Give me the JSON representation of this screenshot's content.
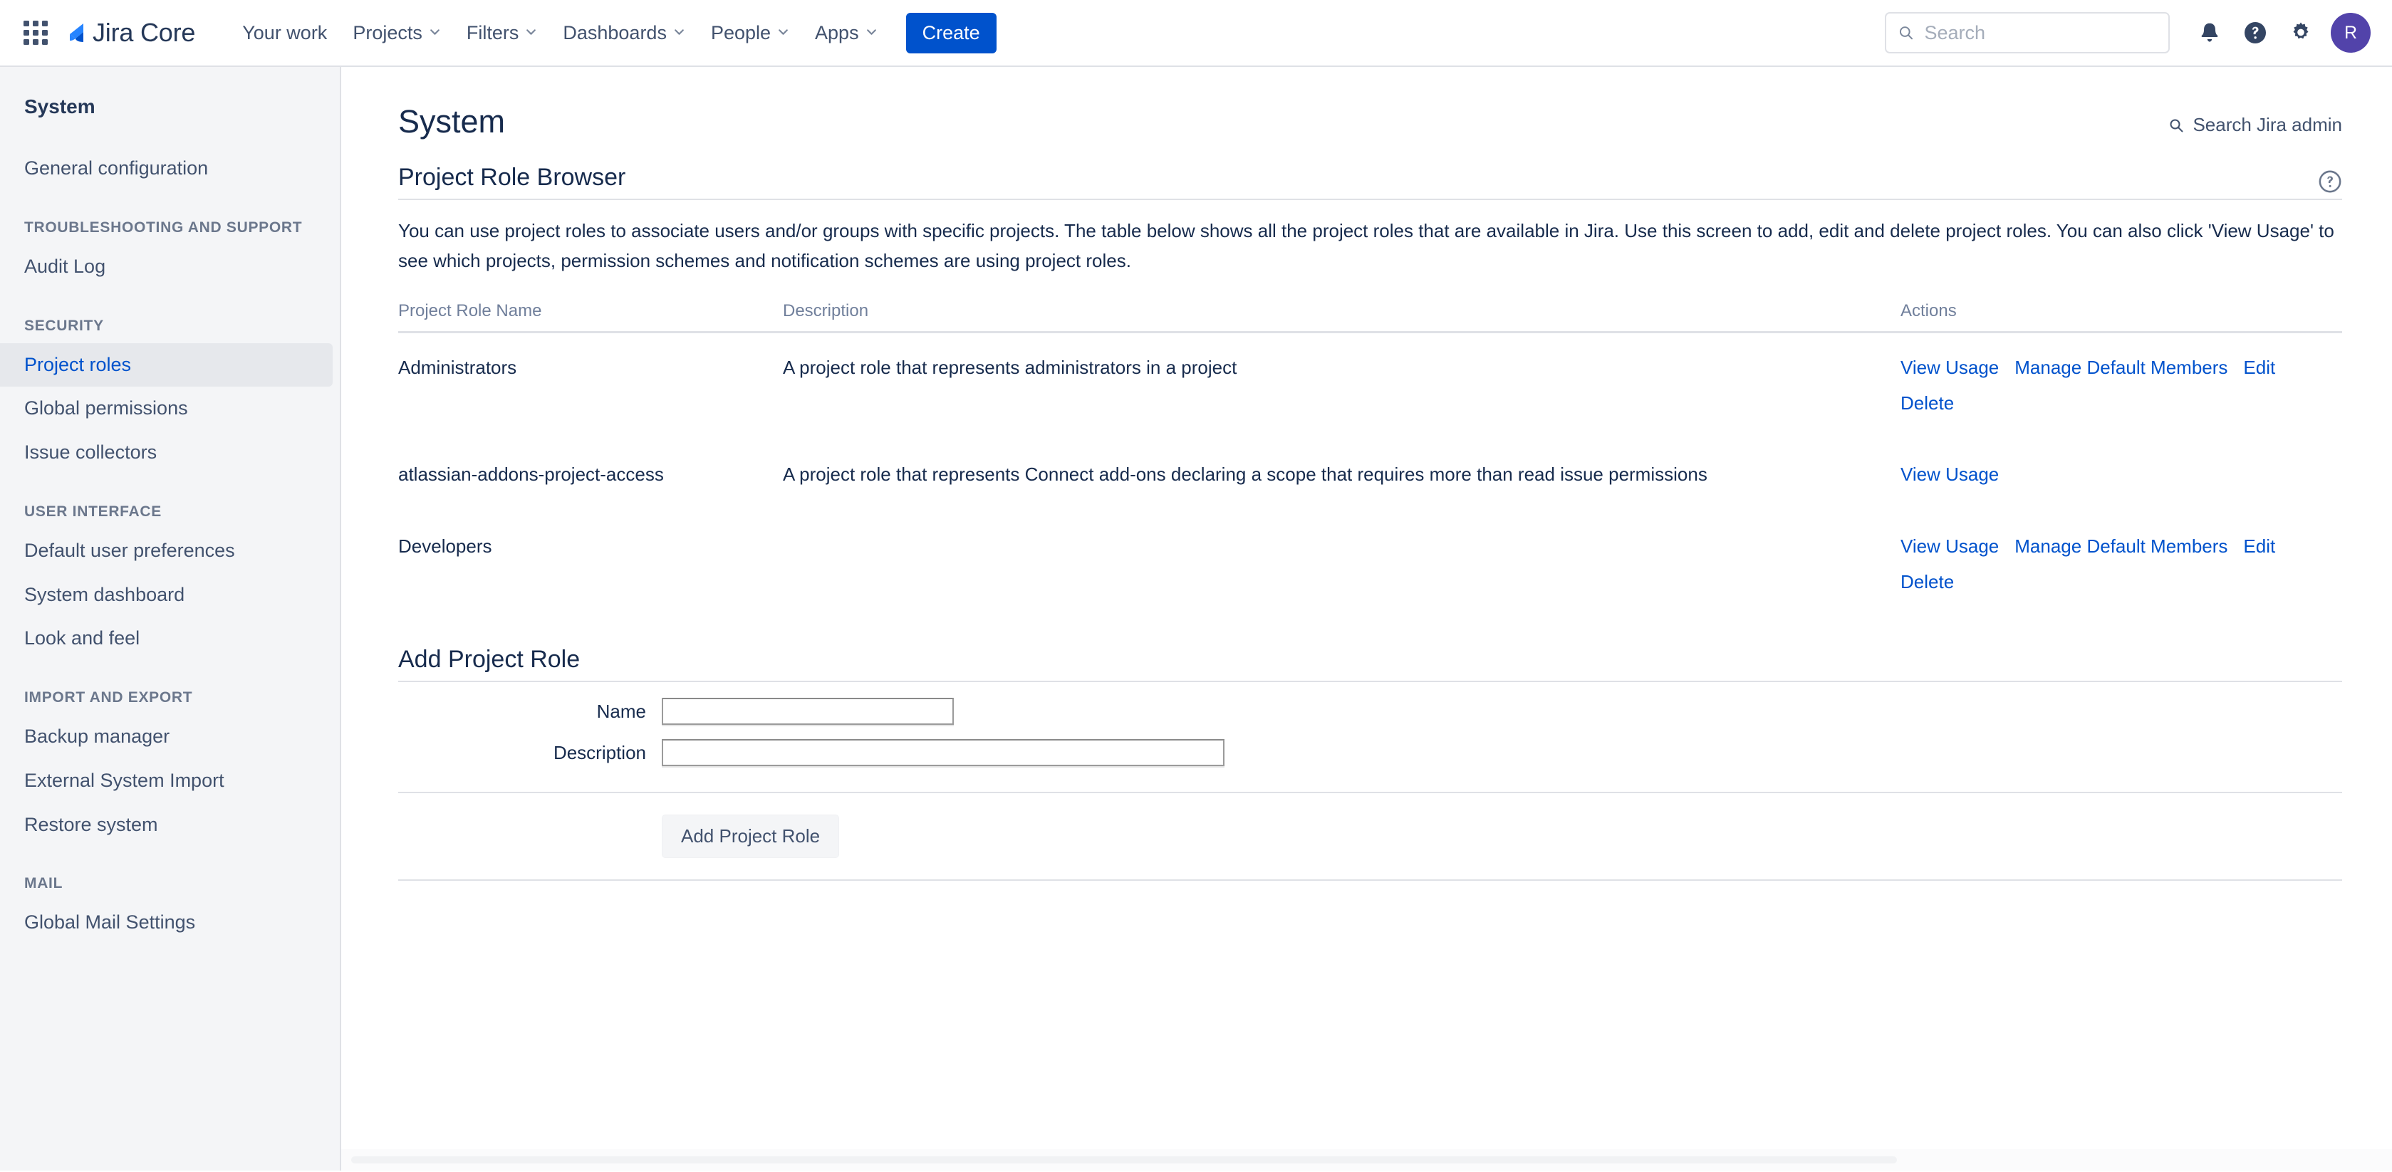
{
  "topnav": {
    "app_switcher_icon": "grid-apps-icon",
    "brand_name": "Jira Core",
    "brand_logo_icon": "jira-logo-icon",
    "items": [
      {
        "label": "Your work",
        "has_chevron": false
      },
      {
        "label": "Projects",
        "has_chevron": true
      },
      {
        "label": "Filters",
        "has_chevron": true
      },
      {
        "label": "Dashboards",
        "has_chevron": true
      },
      {
        "label": "People",
        "has_chevron": true
      },
      {
        "label": "Apps",
        "has_chevron": true
      }
    ],
    "create_label": "Create",
    "search": {
      "placeholder": "Search",
      "value": "",
      "icon": "search-icon"
    },
    "notifications_icon": "bell-icon",
    "help_icon": "help-circle-icon",
    "settings_icon": "gear-icon",
    "avatar_initial": "R",
    "avatar_color": "#5243AA"
  },
  "sidebar": {
    "title": "System",
    "groups": [
      {
        "label": "",
        "items": [
          {
            "label": "General configuration",
            "selected": false
          }
        ]
      },
      {
        "label": "TROUBLESHOOTING AND SUPPORT",
        "items": [
          {
            "label": "Audit Log",
            "selected": false
          }
        ]
      },
      {
        "label": "SECURITY",
        "items": [
          {
            "label": "Project roles",
            "selected": true
          },
          {
            "label": "Global permissions",
            "selected": false
          },
          {
            "label": "Issue collectors",
            "selected": false
          }
        ]
      },
      {
        "label": "USER INTERFACE",
        "items": [
          {
            "label": "Default user preferences",
            "selected": false
          },
          {
            "label": "System dashboard",
            "selected": false
          },
          {
            "label": "Look and feel",
            "selected": false
          }
        ]
      },
      {
        "label": "IMPORT AND EXPORT",
        "items": [
          {
            "label": "Backup manager",
            "selected": false
          },
          {
            "label": "External System Import",
            "selected": false
          },
          {
            "label": "Restore system",
            "selected": false
          }
        ]
      },
      {
        "label": "MAIL",
        "items": [
          {
            "label": "Global Mail Settings",
            "selected": false
          }
        ]
      }
    ]
  },
  "main": {
    "page_title": "System",
    "admin_search_label": "Search Jira admin",
    "admin_search_icon": "search-icon",
    "section_title": "Project Role Browser",
    "help_icon": "help-circle-icon",
    "intro": "You can use project roles to associate users and/or groups with specific projects. The table below shows all the project roles that are available in Jira. Use this screen to add, edit and delete project roles. You can also click 'View Usage' to see which projects, permission schemes and notification schemes are using project roles.",
    "table": {
      "headers": [
        "Project Role Name",
        "Description",
        "Actions"
      ],
      "rows": [
        {
          "name": "Administrators",
          "description": "A project role that represents administrators in a project",
          "actions": [
            "View Usage",
            "Manage Default Members",
            "Edit",
            "Delete"
          ]
        },
        {
          "name": "atlassian-addons-project-access",
          "description": "A project role that represents Connect add-ons declaring a scope that requires more than read issue permissions",
          "actions": [
            "View Usage"
          ]
        },
        {
          "name": "Developers",
          "description": "",
          "actions": [
            "View Usage",
            "Manage Default Members",
            "Edit",
            "Delete"
          ]
        }
      ]
    },
    "form": {
      "title": "Add Project Role",
      "name_label": "Name",
      "name_value": "",
      "description_label": "Description",
      "description_value": "",
      "submit_label": "Add Project Role"
    }
  },
  "colors": {
    "accent": "#0052CC",
    "text": "#172B4D",
    "muted": "#6B778C",
    "sidebar_bg": "#F4F5F7",
    "border": "#DFE1E6",
    "selected_bg": "#E6E8EC"
  }
}
